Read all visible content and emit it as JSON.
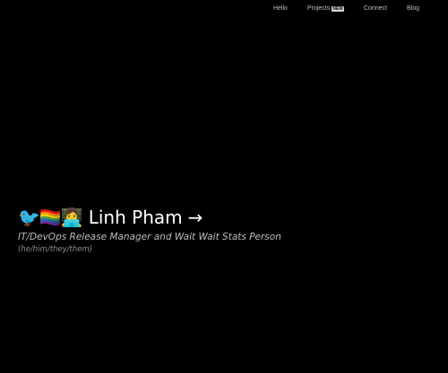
{
  "nav": {
    "items": [
      {
        "label": "Hello"
      },
      {
        "label": "Projects",
        "badge": "🆕"
      },
      {
        "label": "Connect"
      },
      {
        "label": "Blog"
      }
    ]
  },
  "hero": {
    "glyphs": "🐦🏳️‍🌈👩‍💻",
    "name": "Linh Pham",
    "arrow": "→",
    "tagline": "IT/DevOps Release Manager and Wait Wait Stats Person",
    "pronouns": "(he/him/they/them)"
  },
  "colors": {
    "background": "#000000",
    "text": "#ffffff",
    "muted": "#bdbdbd"
  }
}
